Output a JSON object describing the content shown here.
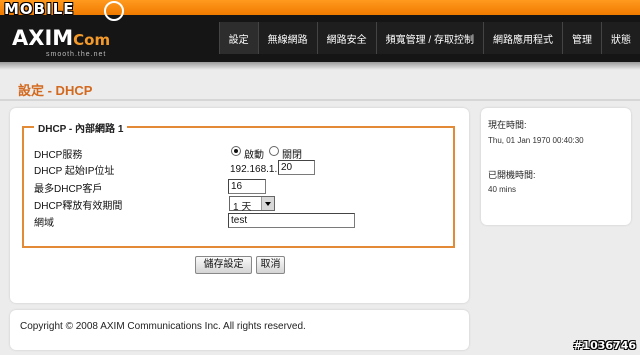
{
  "watermark": {
    "logo_text": "MOBILE",
    "tag": "#1036746"
  },
  "brand": {
    "name": "AXIM",
    "suffix": "Com",
    "tagline": "smooth.the.net"
  },
  "nav": {
    "tabs": [
      "設定",
      "無線網路",
      "網路安全",
      "頻寬管理 / 存取控制",
      "網路應用程式",
      "管理",
      "狀態"
    ]
  },
  "page": {
    "title": "設定 - DHCP"
  },
  "form": {
    "legend": "DHCP - 內部網路 1",
    "dhcp_service": {
      "label": "DHCP服務",
      "option_on": "啟動",
      "option_off": "關閉",
      "selected": "啟動"
    },
    "start_ip": {
      "label": "DHCP 起始IP位址",
      "prefix": "192.168.1.",
      "value": "20"
    },
    "max_clients": {
      "label": "最多DHCP客戶",
      "value": "16"
    },
    "lease_time": {
      "label": "DHCP釋放有效期間",
      "value": "1 天"
    },
    "domain": {
      "label": "網域",
      "value": "test"
    }
  },
  "buttons": {
    "save": "儲存設定",
    "cancel": "取消"
  },
  "footer": {
    "copyright": "Copyright © 2008 AXIM Communications Inc. All rights reserved."
  },
  "status": {
    "current_time_label": "現在時間:",
    "current_time_value": "Thu, 01 Jan 1970 00:40:30",
    "uptime_label": "已開機時間:",
    "uptime_value": "40 mins"
  }
}
